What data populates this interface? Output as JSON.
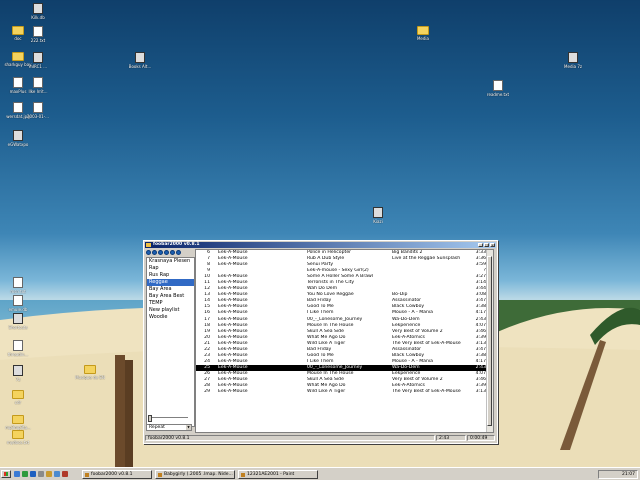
{
  "desktop": {
    "icons": [
      {
        "label": "Kilk.db",
        "kind": "app"
      },
      {
        "label": "doc",
        "kind": "folder"
      },
      {
        "label": "222.txt",
        "kind": "file"
      },
      {
        "label": "sharkguy bay",
        "kind": "folder"
      },
      {
        "label": "mIRC1 ...",
        "kind": "app"
      },
      {
        "label": "maxPlus",
        "kind": "file"
      },
      {
        "label": "Ilke Irrit...",
        "kind": "file"
      },
      {
        "label": "wersdat.jpg",
        "kind": "file"
      },
      {
        "label": "2003-01-...",
        "kind": "file"
      },
      {
        "label": "eGWatxpo",
        "kind": "app"
      },
      {
        "label": "Books Alt...",
        "kind": "app"
      },
      {
        "label": "Media",
        "kind": "folder"
      },
      {
        "label": "Media 7z",
        "kind": "app"
      },
      {
        "label": "readme.txt",
        "kind": "file"
      },
      {
        "label": "msn.txt",
        "kind": "file"
      },
      {
        "label": "Shortcuts",
        "kind": "app"
      },
      {
        "label": "threadin...",
        "kind": "file"
      },
      {
        "label": "emule.db",
        "kind": "file"
      },
      {
        "label": "7z",
        "kind": "app"
      },
      {
        "label": "cdr",
        "kind": "folder"
      },
      {
        "label": "mp3mp3ta...",
        "kind": "folder"
      },
      {
        "label": "Musique de EN",
        "kind": "folder"
      },
      {
        "label": "Kiazi",
        "kind": "app"
      },
      {
        "label": "mydocs.txt",
        "kind": "folder"
      }
    ]
  },
  "player": {
    "title": "foobar2000 v0.8.1",
    "window_buttons": [
      "_",
      "□",
      "×"
    ],
    "controls": [
      "stop-icon",
      "play-icon",
      "pause-icon",
      "prev-icon",
      "next-icon",
      "random-icon"
    ],
    "playlists": [
      {
        "name": "Krasnaya Plesen",
        "selected": false
      },
      {
        "name": "Rap",
        "selected": false
      },
      {
        "name": "Rus Rap",
        "selected": false
      },
      {
        "name": "Reggae",
        "selected": true
      },
      {
        "name": "Bay Area",
        "selected": false
      },
      {
        "name": "Bay Area Best",
        "selected": false
      },
      {
        "name": "TEMP",
        "selected": false
      },
      {
        "name": "New playlist",
        "selected": false
      },
      {
        "name": "Woodie",
        "selected": false
      }
    ],
    "order_value": "Repeat",
    "tracks": [
      {
        "num": "6",
        "artist": "Eek-A-Mouse",
        "title": "Police in Helicopter",
        "album": "Big Bandits 2",
        "length": "3:33"
      },
      {
        "num": "7",
        "artist": "Eek-A-Mouse",
        "title": "Rub A Dub Style",
        "album": "Live at the Reggae Sunsplash",
        "length": "3:36"
      },
      {
        "num": "8",
        "artist": "Eek-A-Mouse",
        "title": "Senui Party",
        "album": "",
        "length": "3:59"
      },
      {
        "num": "9",
        "artist": "",
        "title": "Eek-A-mouse - Sexy Girl(2)",
        "album": "",
        "length": "?"
      },
      {
        "num": "10",
        "artist": "Eek-A-Mouse",
        "title": "Some A Holler Some A Brawl",
        "album": "",
        "length": "3:27"
      },
      {
        "num": "11",
        "artist": "Eek-A-Mouse",
        "title": "Terrorists in The City",
        "album": "",
        "length": "3:14"
      },
      {
        "num": "12",
        "artist": "Eek-A-Mouse",
        "title": "Wah Do Dem",
        "album": "",
        "length": "3:44"
      },
      {
        "num": "13",
        "artist": "Eek-A-Mouse",
        "title": "You No Love Reggae",
        "album": "Bo-Dip",
        "length": "3:08"
      },
      {
        "num": "14",
        "artist": "Eek-A-Mouse",
        "title": "Bad Friday",
        "album": "Assassinator",
        "length": "3:47"
      },
      {
        "num": "15",
        "artist": "Eek-A-Mouse",
        "title": "Good To Me",
        "album": "Black Cowboy",
        "length": "3:38"
      },
      {
        "num": "16",
        "artist": "Eek-A-Mouse",
        "title": "I Like Them",
        "album": "Mouse - A - Mania",
        "length": "4:17"
      },
      {
        "num": "17",
        "artist": "Eek-A-Mouse",
        "title": "00_-_Lonesome_Journey",
        "album": "Wa-Do-Dem",
        "length": "2:43"
      },
      {
        "num": "18",
        "artist": "Eek-A-Mouse",
        "title": "Mouse In The House",
        "album": "Eekperience",
        "length": "4:07"
      },
      {
        "num": "19",
        "artist": "Eek-A-Mouse",
        "title": "Skull A Sea Side",
        "album": "Very Best of Volume 2",
        "length": "3:46"
      },
      {
        "num": "20",
        "artist": "Eek-A-Mouse",
        "title": "What Me Ago Do",
        "album": "Eek-A-Atomics",
        "length": "3:39"
      },
      {
        "num": "21",
        "artist": "Eek-A-Mouse",
        "title": "Wild Like A Tiger",
        "album": "The Very Best of Eek-A-Mouse",
        "length": "3:13"
      },
      {
        "num": "22",
        "artist": "Eek-A-Mouse",
        "title": "Bad Friday",
        "album": "Assassinator",
        "length": "3:47"
      },
      {
        "num": "23",
        "artist": "Eek-A-Mouse",
        "title": "Good To Me",
        "album": "Black Cowboy",
        "length": "3:38"
      },
      {
        "num": "24",
        "artist": "Eek-A-Mouse",
        "title": "I Like Them",
        "album": "Mouse - A - Mania",
        "length": "4:17"
      },
      {
        "num": "25",
        "artist": "Eek-A-Mouse",
        "title": "00_-_Lonesome_Journey",
        "album": "Wa-Do-Dem",
        "length": "2:43"
      },
      {
        "num": "26",
        "artist": "Eek-A-Mouse",
        "title": "Mouse In The House",
        "album": "Eekperience",
        "length": "4:07"
      },
      {
        "num": "27",
        "artist": "Eek-A-Mouse",
        "title": "Skull A Sea Side",
        "album": "Very Best of Volume 2",
        "length": "3:46"
      },
      {
        "num": "28",
        "artist": "Eek-A-Mouse",
        "title": "What Me Ago Do",
        "album": "Eek-A-Atomics",
        "length": "3:39"
      },
      {
        "num": "29",
        "artist": "Eek-A-Mouse",
        "title": "Wild Like A Tiger",
        "album": "The Very Best of Eek-A-Mouse",
        "length": "3:13"
      }
    ],
    "selected_track_index": 19,
    "status": {
      "left": "foobar2000 v0.8.1",
      "time": "2:43",
      "elapsed": "0:00:49"
    }
  },
  "taskbar": {
    "tasks": [
      "foobar2000 v0.8.1",
      "Babygirly (.2005 .lmap. Nide...",
      "12321AE2001 - Paint"
    ],
    "clock": "21:07"
  },
  "colors": {
    "selection": "#316ac5",
    "titlebar_start": "#0a246a",
    "titlebar_end": "#a6caf0",
    "window_face": "#d4d0c8"
  }
}
